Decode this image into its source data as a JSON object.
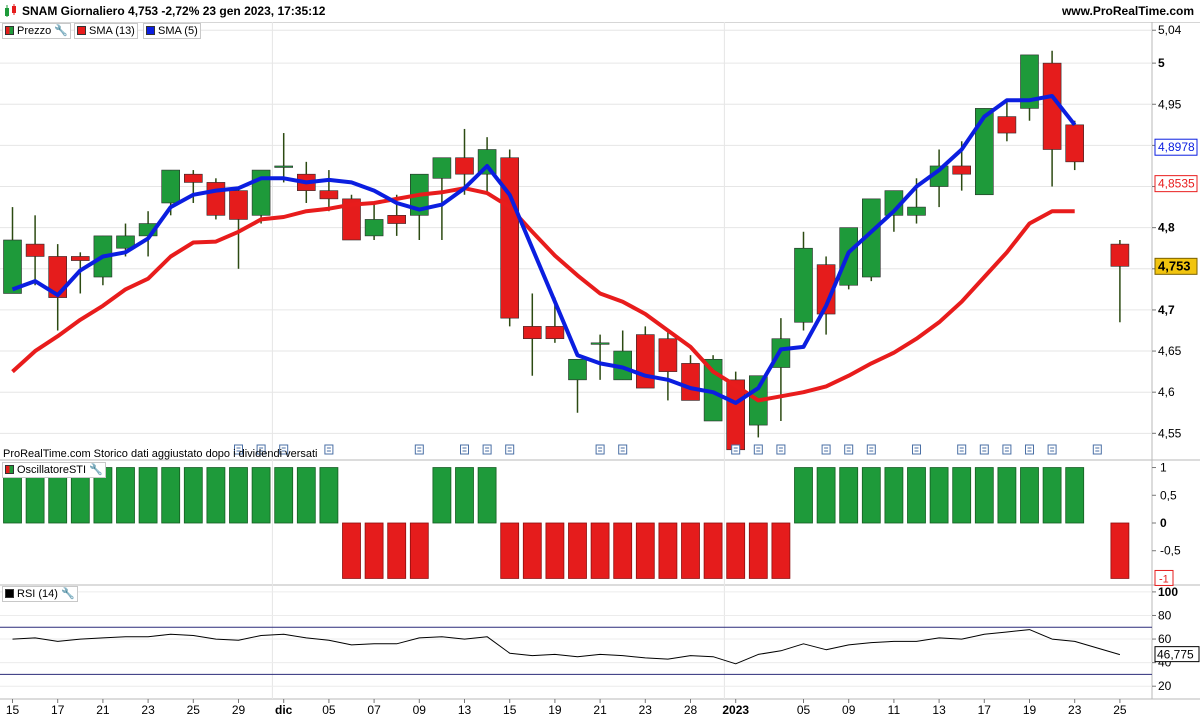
{
  "header": {
    "title": "SNAM Giornaliero 4,753 -2,72% 23 gen 2023, 17:35:12",
    "site": "www.ProRealTime.com"
  },
  "legends": {
    "price": "Prezzo",
    "sma13": "SMA (13)",
    "sma5": "SMA (5)",
    "osc": "OscillatoreSTI",
    "rsi": "RSI (14)"
  },
  "footnote": "ProRealTime.com Storico dati aggiustato dopo i dividendi versati",
  "colors": {
    "up": "#1e9a3a",
    "down": "#e51c1c",
    "sma13": "#e81c1c",
    "sma5": "#0b1ee0",
    "wick": "#2c4a12",
    "priceTag": "#f1c40f"
  },
  "chart_data": [
    {
      "type": "candlestick",
      "panel": "price",
      "title": "SNAM Giornaliero",
      "ylim": [
        4.52,
        5.05
      ],
      "yticks": [
        "5,04",
        "5",
        "4,95",
        "4,9",
        "4,85",
        "4,8",
        "4,75",
        "4,7",
        "4,65",
        "4,6",
        "4,55"
      ],
      "ytick_values": [
        5.04,
        5.0,
        4.95,
        4.9,
        4.85,
        4.8,
        4.75,
        4.7,
        4.65,
        4.6,
        4.55
      ],
      "xticks": [
        "15",
        "17",
        "21",
        "23",
        "25",
        "29",
        "dic",
        "05",
        "07",
        "09",
        "13",
        "15",
        "19",
        "21",
        "23",
        "28",
        "2023",
        "05",
        "09",
        "11",
        "13",
        "17",
        "19",
        "23",
        "25"
      ],
      "xtick_index": [
        0,
        2,
        4,
        6,
        8,
        10,
        12,
        14,
        16,
        18,
        20,
        22,
        24,
        26,
        28,
        30,
        32,
        35,
        37,
        39,
        41,
        43,
        45,
        47,
        49
      ],
      "ohlc": [
        [
          4.72,
          4.825,
          4.73,
          4.785
        ],
        [
          4.78,
          4.815,
          4.73,
          4.765
        ],
        [
          4.765,
          4.78,
          4.675,
          4.715
        ],
        [
          4.765,
          4.77,
          4.72,
          4.76
        ],
        [
          4.74,
          4.79,
          4.73,
          4.79
        ],
        [
          4.775,
          4.805,
          4.765,
          4.79
        ],
        [
          4.79,
          4.82,
          4.765,
          4.805
        ],
        [
          4.83,
          4.87,
          4.815,
          4.87
        ],
        [
          4.865,
          4.87,
          4.83,
          4.855
        ],
        [
          4.855,
          4.86,
          4.81,
          4.815
        ],
        [
          4.845,
          4.85,
          4.75,
          4.81
        ],
        [
          4.815,
          4.865,
          4.805,
          4.87
        ],
        [
          4.875,
          4.915,
          4.855,
          4.875
        ],
        [
          4.865,
          4.88,
          4.83,
          4.845
        ],
        [
          4.845,
          4.87,
          4.82,
          4.835
        ],
        [
          4.835,
          4.84,
          4.785,
          4.785
        ],
        [
          4.79,
          4.83,
          4.785,
          4.81
        ],
        [
          4.815,
          4.84,
          4.79,
          4.805
        ],
        [
          4.815,
          4.85,
          4.785,
          4.865
        ],
        [
          4.86,
          4.885,
          4.785,
          4.885
        ],
        [
          4.885,
          4.92,
          4.84,
          4.865
        ],
        [
          4.865,
          4.91,
          4.84,
          4.895
        ],
        [
          4.885,
          4.895,
          4.68,
          4.69
        ],
        [
          4.68,
          4.72,
          4.62,
          4.665
        ],
        [
          4.68,
          4.715,
          4.66,
          4.665
        ],
        [
          4.615,
          4.64,
          4.575,
          4.64
        ],
        [
          4.66,
          4.67,
          4.615,
          4.66
        ],
        [
          4.615,
          4.675,
          4.615,
          4.65
        ],
        [
          4.67,
          4.68,
          4.61,
          4.605
        ],
        [
          4.665,
          4.675,
          4.59,
          4.625
        ],
        [
          4.635,
          4.645,
          4.595,
          4.59
        ],
        [
          4.565,
          4.645,
          4.565,
          4.64
        ],
        [
          4.615,
          4.625,
          4.53,
          4.53
        ],
        [
          4.56,
          4.595,
          4.545,
          4.62
        ],
        [
          4.63,
          4.69,
          4.565,
          4.665
        ],
        [
          4.685,
          4.795,
          4.675,
          4.775
        ],
        [
          4.755,
          4.765,
          4.67,
          4.695
        ],
        [
          4.73,
          4.79,
          4.725,
          4.8
        ],
        [
          4.74,
          4.805,
          4.735,
          4.835
        ],
        [
          4.815,
          4.845,
          4.795,
          4.845
        ],
        [
          4.815,
          4.86,
          4.805,
          4.825
        ],
        [
          4.85,
          4.895,
          4.825,
          4.875
        ],
        [
          4.875,
          4.905,
          4.845,
          4.865
        ],
        [
          4.84,
          4.945,
          4.84,
          4.945
        ],
        [
          4.935,
          4.955,
          4.905,
          4.915
        ],
        [
          4.945,
          4.99,
          4.93,
          5.01
        ],
        [
          5.0,
          5.015,
          4.85,
          4.895
        ],
        [
          4.925,
          4.93,
          4.87,
          4.88
        ],
        null,
        [
          4.78,
          4.785,
          4.685,
          4.753
        ]
      ],
      "sma13": [
        4.625,
        4.65,
        4.668,
        4.688,
        4.705,
        4.725,
        4.738,
        4.765,
        4.782,
        4.783,
        4.795,
        4.81,
        4.813,
        4.82,
        4.823,
        4.828,
        4.83,
        4.835,
        4.84,
        4.843,
        4.848,
        4.842,
        4.825,
        4.795,
        4.766,
        4.742,
        4.72,
        4.71,
        4.695,
        4.675,
        4.655,
        4.625,
        4.608,
        4.59,
        4.595,
        4.6,
        4.607,
        4.62,
        4.635,
        4.648,
        4.665,
        4.685,
        4.71,
        4.74,
        4.77,
        4.805,
        4.82,
        4.82,
        null,
        null
      ],
      "sma5": [
        4.725,
        4.735,
        4.718,
        4.748,
        4.765,
        4.77,
        4.787,
        4.825,
        4.84,
        4.845,
        4.848,
        4.86,
        4.86,
        4.855,
        4.858,
        4.855,
        4.845,
        4.83,
        4.822,
        4.828,
        4.848,
        4.875,
        4.84,
        4.775,
        4.71,
        4.645,
        4.635,
        4.63,
        4.62,
        4.615,
        4.605,
        4.6,
        4.587,
        4.605,
        4.652,
        4.655,
        4.705,
        4.77,
        4.795,
        4.82,
        4.85,
        4.87,
        4.895,
        4.935,
        4.955,
        4.955,
        4.96,
        4.925,
        null,
        null
      ],
      "price_tags": [
        "4,8978",
        "4,8535",
        "4,753"
      ],
      "price_tag_values": [
        4.8978,
        4.8535,
        4.753
      ]
    },
    {
      "type": "bar",
      "panel": "oscillator",
      "title": "OscillatoreSTI",
      "ylim": [
        -1.1,
        1.1
      ],
      "yticks": [
        "1",
        "0,5",
        "0",
        "-0,5"
      ],
      "ytick_values": [
        1,
        0.5,
        0,
        -0.5
      ],
      "last_label": "-1",
      "values": [
        1,
        1,
        1,
        1,
        1,
        1,
        1,
        1,
        1,
        1,
        1,
        1,
        1,
        1,
        1,
        -1,
        -1,
        -1,
        -1,
        1,
        1,
        1,
        -1,
        -1,
        -1,
        -1,
        -1,
        -1,
        -1,
        -1,
        -1,
        -1,
        -1,
        -1,
        -1,
        1,
        1,
        1,
        1,
        1,
        1,
        1,
        1,
        1,
        1,
        1,
        1,
        1,
        null,
        -1
      ]
    },
    {
      "type": "line",
      "panel": "rsi",
      "title": "RSI (14)",
      "ylim": [
        10,
        105
      ],
      "yticks": [
        "100",
        "80",
        "60",
        "40",
        "20"
      ],
      "ytick_values": [
        100,
        80,
        60,
        40,
        20
      ],
      "hlines": [
        70,
        30
      ],
      "last_label": "46,775",
      "values": [
        60,
        61,
        58,
        60,
        61,
        62,
        62,
        64,
        63,
        60,
        59,
        63,
        64,
        61,
        59,
        55,
        56,
        56,
        61,
        62,
        60,
        62,
        48,
        46,
        47,
        45,
        47,
        46,
        44,
        43,
        46,
        45,
        39,
        47,
        50,
        56,
        51,
        55,
        57,
        58,
        58,
        61,
        60,
        64,
        66,
        68,
        60,
        58,
        null,
        46.775
      ]
    }
  ],
  "icon_columns": [
    10,
    11,
    12,
    14,
    18,
    20,
    21,
    22,
    26,
    27,
    32,
    33,
    34,
    36,
    37,
    38,
    40,
    42,
    43,
    44,
    45,
    46,
    48
  ]
}
